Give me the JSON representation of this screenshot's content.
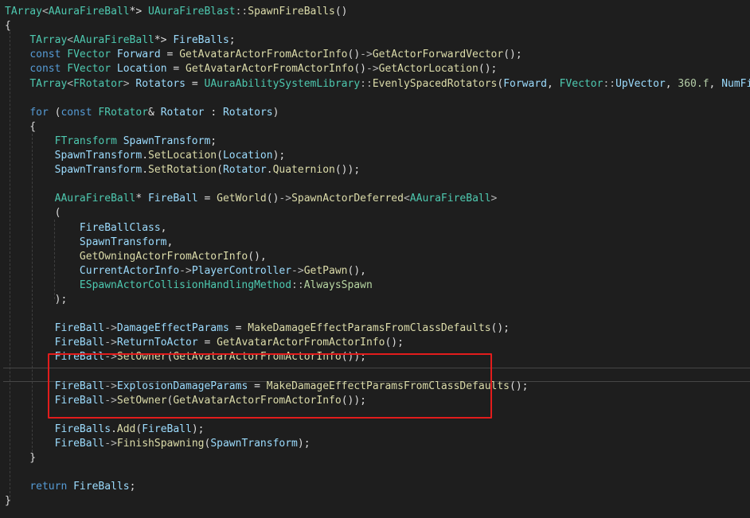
{
  "colors": {
    "background": "#1e1e1e",
    "type": "#4ec9b0",
    "keyword": "#569cd6",
    "function": "#dcdcaa",
    "variable": "#9cdcfe",
    "operator": "#b4b4b4",
    "number": "#b5cea8",
    "plain": "#dcdcdc",
    "highlight_box": "#e21c1c"
  },
  "code_lines": [
    [
      [
        "type",
        "TArray"
      ],
      [
        "op",
        "<"
      ],
      [
        "type",
        "AAuraFireBall"
      ],
      [
        "plain",
        "*> "
      ],
      [
        "type",
        "UAuraFireBlast"
      ],
      [
        "op",
        "::"
      ],
      [
        "fn",
        "SpawnFireBalls"
      ],
      [
        "plain",
        "()"
      ]
    ],
    [
      [
        "plain",
        "{"
      ]
    ],
    [
      [
        "plain",
        "    "
      ],
      [
        "type",
        "TArray"
      ],
      [
        "op",
        "<"
      ],
      [
        "type",
        "AAuraFireBall"
      ],
      [
        "plain",
        "*> "
      ],
      [
        "var",
        "FireBalls"
      ],
      [
        "plain",
        ";"
      ]
    ],
    [
      [
        "plain",
        "    "
      ],
      [
        "kw",
        "const "
      ],
      [
        "type",
        "FVector "
      ],
      [
        "var",
        "Forward"
      ],
      [
        "plain",
        " = "
      ],
      [
        "fn",
        "GetAvatarActorFromActorInfo"
      ],
      [
        "plain",
        "()"
      ],
      [
        "op",
        "->"
      ],
      [
        "fn",
        "GetActorForwardVector"
      ],
      [
        "plain",
        "();"
      ]
    ],
    [
      [
        "plain",
        "    "
      ],
      [
        "kw",
        "const "
      ],
      [
        "type",
        "FVector "
      ],
      [
        "var",
        "Location"
      ],
      [
        "plain",
        " = "
      ],
      [
        "fn",
        "GetAvatarActorFromActorInfo"
      ],
      [
        "plain",
        "()"
      ],
      [
        "op",
        "->"
      ],
      [
        "fn",
        "GetActorLocation"
      ],
      [
        "plain",
        "();"
      ]
    ],
    [
      [
        "plain",
        "    "
      ],
      [
        "type",
        "TArray"
      ],
      [
        "op",
        "<"
      ],
      [
        "type",
        "FRotator"
      ],
      [
        "op",
        "> "
      ],
      [
        "var",
        "Rotators"
      ],
      [
        "plain",
        " = "
      ],
      [
        "type",
        "UAuraAbilitySystemLibrary"
      ],
      [
        "op",
        "::"
      ],
      [
        "fn",
        "EvenlySpacedRotators"
      ],
      [
        "plain",
        "("
      ],
      [
        "var",
        "Forward"
      ],
      [
        "plain",
        ", "
      ],
      [
        "type",
        "FVector"
      ],
      [
        "op",
        "::"
      ],
      [
        "var",
        "UpVector"
      ],
      [
        "plain",
        ", "
      ],
      [
        "num",
        "360.f"
      ],
      [
        "plain",
        ", "
      ],
      [
        "var",
        "NumFireBalls"
      ],
      [
        "plain",
        ");"
      ]
    ],
    [],
    [
      [
        "plain",
        "    "
      ],
      [
        "kw",
        "for "
      ],
      [
        "plain",
        "("
      ],
      [
        "kw",
        "const "
      ],
      [
        "type",
        "FRotator"
      ],
      [
        "plain",
        "& "
      ],
      [
        "var",
        "Rotator"
      ],
      [
        "plain",
        " : "
      ],
      [
        "var",
        "Rotators"
      ],
      [
        "plain",
        ")"
      ]
    ],
    [
      [
        "plain",
        "    {"
      ]
    ],
    [
      [
        "plain",
        "        "
      ],
      [
        "type",
        "FTransform "
      ],
      [
        "var",
        "SpawnTransform"
      ],
      [
        "plain",
        ";"
      ]
    ],
    [
      [
        "plain",
        "        "
      ],
      [
        "var",
        "SpawnTransform"
      ],
      [
        "plain",
        "."
      ],
      [
        "fn",
        "SetLocation"
      ],
      [
        "plain",
        "("
      ],
      [
        "var",
        "Location"
      ],
      [
        "plain",
        ");"
      ]
    ],
    [
      [
        "plain",
        "        "
      ],
      [
        "var",
        "SpawnTransform"
      ],
      [
        "plain",
        "."
      ],
      [
        "fn",
        "SetRotation"
      ],
      [
        "plain",
        "("
      ],
      [
        "var",
        "Rotator"
      ],
      [
        "plain",
        "."
      ],
      [
        "fn",
        "Quaternion"
      ],
      [
        "plain",
        "());"
      ]
    ],
    [],
    [
      [
        "plain",
        "        "
      ],
      [
        "type",
        "AAuraFireBall"
      ],
      [
        "plain",
        "* "
      ],
      [
        "var",
        "FireBall"
      ],
      [
        "plain",
        " = "
      ],
      [
        "fn",
        "GetWorld"
      ],
      [
        "plain",
        "()"
      ],
      [
        "op",
        "->"
      ],
      [
        "fn",
        "SpawnActorDeferred"
      ],
      [
        "op",
        "<"
      ],
      [
        "type",
        "AAuraFireBall"
      ],
      [
        "op",
        ">"
      ]
    ],
    [
      [
        "plain",
        "        ("
      ]
    ],
    [
      [
        "plain",
        "            "
      ],
      [
        "var",
        "FireBallClass"
      ],
      [
        "plain",
        ","
      ]
    ],
    [
      [
        "plain",
        "            "
      ],
      [
        "var",
        "SpawnTransform"
      ],
      [
        "plain",
        ","
      ]
    ],
    [
      [
        "plain",
        "            "
      ],
      [
        "fn",
        "GetOwningActorFromActorInfo"
      ],
      [
        "plain",
        "(),"
      ]
    ],
    [
      [
        "plain",
        "            "
      ],
      [
        "var",
        "CurrentActorInfo"
      ],
      [
        "op",
        "->"
      ],
      [
        "var",
        "PlayerController"
      ],
      [
        "op",
        "->"
      ],
      [
        "fn",
        "GetPawn"
      ],
      [
        "plain",
        "(),"
      ]
    ],
    [
      [
        "plain",
        "            "
      ],
      [
        "type",
        "ESpawnActorCollisionHandlingMethod"
      ],
      [
        "op",
        "::"
      ],
      [
        "enum",
        "AlwaysSpawn"
      ]
    ],
    [
      [
        "plain",
        "        );"
      ]
    ],
    [],
    [
      [
        "plain",
        "        "
      ],
      [
        "var",
        "FireBall"
      ],
      [
        "op",
        "->"
      ],
      [
        "var",
        "DamageEffectParams"
      ],
      [
        "plain",
        " = "
      ],
      [
        "fn",
        "MakeDamageEffectParamsFromClassDefaults"
      ],
      [
        "plain",
        "();"
      ]
    ],
    [
      [
        "plain",
        "        "
      ],
      [
        "var",
        "FireBall"
      ],
      [
        "op",
        "->"
      ],
      [
        "var",
        "ReturnToActor"
      ],
      [
        "plain",
        " = "
      ],
      [
        "fn",
        "GetAvatarActorFromActorInfo"
      ],
      [
        "plain",
        "();"
      ]
    ],
    [
      [
        "plain",
        "        "
      ],
      [
        "var",
        "FireBall"
      ],
      [
        "op",
        "->"
      ],
      [
        "fn",
        "SetOwner"
      ],
      [
        "plain",
        "("
      ],
      [
        "fn",
        "GetAvatarActorFromActorInfo"
      ],
      [
        "plain",
        "());"
      ]
    ],
    [],
    [
      [
        "plain",
        "        "
      ],
      [
        "var",
        "FireBall"
      ],
      [
        "op",
        "->"
      ],
      [
        "var",
        "ExplosionDamageParams"
      ],
      [
        "plain",
        " = "
      ],
      [
        "fn",
        "MakeDamageEffectParamsFromClassDefaults"
      ],
      [
        "plain",
        "();"
      ]
    ],
    [
      [
        "plain",
        "        "
      ],
      [
        "var",
        "FireBall"
      ],
      [
        "op",
        "->"
      ],
      [
        "fn",
        "SetOwner"
      ],
      [
        "plain",
        "("
      ],
      [
        "fn",
        "GetAvatarActorFromActorInfo"
      ],
      [
        "plain",
        "());"
      ]
    ],
    [],
    [
      [
        "plain",
        "        "
      ],
      [
        "var",
        "FireBalls"
      ],
      [
        "plain",
        "."
      ],
      [
        "fn",
        "Add"
      ],
      [
        "plain",
        "("
      ],
      [
        "var",
        "FireBall"
      ],
      [
        "plain",
        ");"
      ]
    ],
    [
      [
        "plain",
        "        "
      ],
      [
        "var",
        "FireBall"
      ],
      [
        "op",
        "->"
      ],
      [
        "fn",
        "FinishSpawning"
      ],
      [
        "plain",
        "("
      ],
      [
        "var",
        "SpawnTransform"
      ],
      [
        "plain",
        ");"
      ]
    ],
    [
      [
        "plain",
        "    }"
      ]
    ],
    [],
    [
      [
        "plain",
        "    "
      ],
      [
        "kw",
        "return "
      ],
      [
        "var",
        "FireBalls"
      ],
      [
        "plain",
        ";"
      ]
    ],
    [
      [
        "plain",
        "}"
      ]
    ]
  ]
}
